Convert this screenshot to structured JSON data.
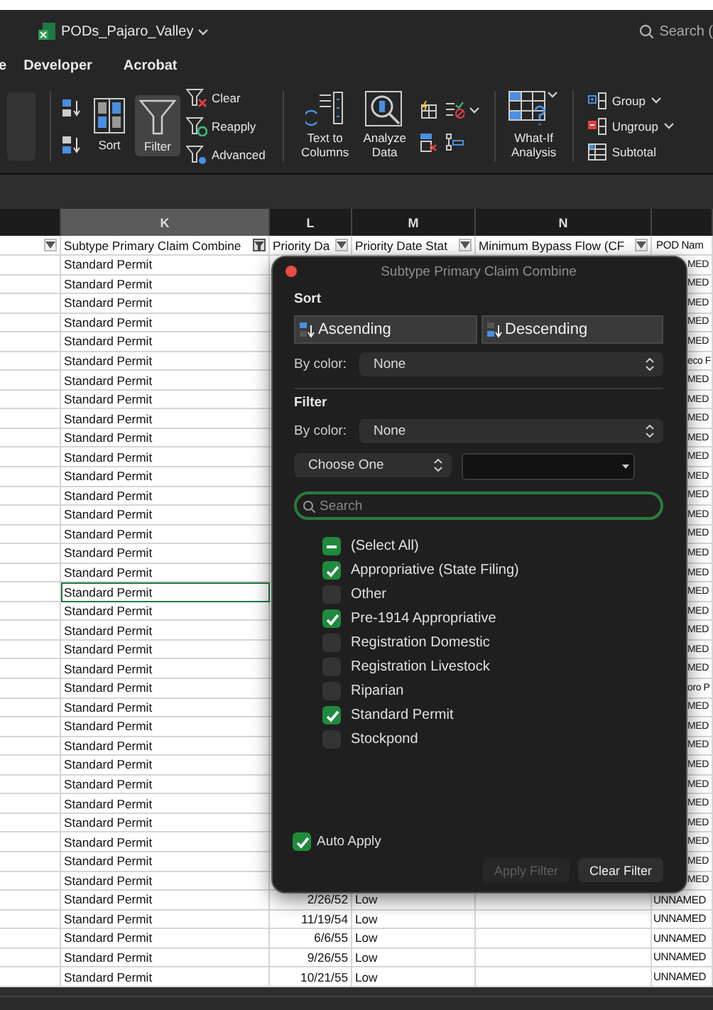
{
  "window": {
    "title": "PODs_Pajaro_Valley",
    "search": "Search ("
  },
  "tabs": [
    {
      "label": "e",
      "selected": false
    },
    {
      "label": "Developer",
      "selected": false
    },
    {
      "label": "Acrobat",
      "selected": false
    }
  ],
  "ribbon": {
    "sort": "Sort",
    "filter": {
      "label": "Filter",
      "selected": true
    },
    "filter_actions": [
      "Clear",
      "Reapply",
      "Advanced"
    ],
    "data_tools": [
      "Text to Columns",
      "Analyze Data"
    ],
    "what_if": "What-If Analysis",
    "outline": [
      "Group",
      "Ungroup",
      "Subtotal"
    ]
  },
  "sheet": {
    "column_letters": [
      {
        "label": "K",
        "selected": true
      },
      {
        "label": "L",
        "selected": false
      },
      {
        "label": "M",
        "selected": false
      },
      {
        "label": "N",
        "selected": false
      }
    ],
    "headers": [
      {
        "label": "Subtype Primary Claim Combine",
        "filtered": true
      },
      {
        "label": "Priority Da",
        "filtered": false
      },
      {
        "label": "Priority Date Stat",
        "filtered": false
      },
      {
        "label": "Minimum Bypass Flow (CF",
        "filtered": false
      },
      {
        "label": "POD Nam"
      }
    ],
    "rows": [
      {
        "subtype": "Standard Permit",
        "pod_name": "MED",
        "selected": false
      },
      {
        "subtype": "Standard Permit",
        "pod_name": "MED",
        "selected": false
      },
      {
        "subtype": "Standard Permit",
        "pod_name": "MED",
        "selected": false
      },
      {
        "subtype": "Standard Permit",
        "pod_name": "MED",
        "selected": false
      },
      {
        "subtype": "Standard Permit",
        "pod_name": "MED",
        "selected": false
      },
      {
        "subtype": "Standard Permit",
        "pod_name": "eco F",
        "selected": false
      },
      {
        "subtype": "Standard Permit",
        "pod_name": "MED",
        "selected": false
      },
      {
        "subtype": "Standard Permit",
        "pod_name": "MED",
        "selected": false
      },
      {
        "subtype": "Standard Permit",
        "pod_name": "MED",
        "selected": false
      },
      {
        "subtype": "Standard Permit",
        "pod_name": "MED",
        "selected": false
      },
      {
        "subtype": "Standard Permit",
        "pod_name": "MED",
        "selected": false
      },
      {
        "subtype": "Standard Permit",
        "pod_name": "MED",
        "selected": false
      },
      {
        "subtype": "Standard Permit",
        "pod_name": "MED",
        "selected": false
      },
      {
        "subtype": "Standard Permit",
        "pod_name": "MED",
        "selected": false
      },
      {
        "subtype": "Standard Permit",
        "pod_name": "MED",
        "selected": false
      },
      {
        "subtype": "Standard Permit",
        "pod_name": "MED",
        "selected": false
      },
      {
        "subtype": "Standard Permit",
        "pod_name": "MED",
        "selected": false
      },
      {
        "subtype": "Standard Permit",
        "pod_name": "MED",
        "selected": true
      },
      {
        "subtype": "Standard Permit",
        "pod_name": "MED",
        "selected": false
      },
      {
        "subtype": "Standard Permit",
        "pod_name": "MED",
        "selected": false
      },
      {
        "subtype": "Standard Permit",
        "pod_name": "MED",
        "selected": false
      },
      {
        "subtype": "Standard Permit",
        "pod_name": "MED",
        "selected": false
      },
      {
        "subtype": "Standard Permit",
        "pod_name": "oro P",
        "selected": false
      },
      {
        "subtype": "Standard Permit",
        "pod_name": "MED",
        "selected": false
      },
      {
        "subtype": "Standard Permit",
        "pod_name": "MED",
        "selected": false
      },
      {
        "subtype": "Standard Permit",
        "pod_name": "MED",
        "selected": false
      },
      {
        "subtype": "Standard Permit",
        "pod_name": "MED",
        "selected": false
      },
      {
        "subtype": "Standard Permit",
        "pod_name": "MED",
        "selected": false
      },
      {
        "subtype": "Standard Permit",
        "pod_name": "MED",
        "selected": false
      },
      {
        "subtype": "Standard Permit",
        "pod_name": "MED",
        "selected": false
      },
      {
        "subtype": "Standard Permit",
        "pod_name": "MED",
        "selected": false
      },
      {
        "subtype": "Standard Permit",
        "pod_name": "MED",
        "selected": false
      },
      {
        "subtype": "Standard Permit",
        "pod_name": "MED",
        "selected": false
      },
      {
        "subtype": "Standard Permit",
        "priority_date": "2/26/52",
        "priority_date_status": "Low",
        "pod_name": "UNNAMED",
        "selected": false
      },
      {
        "subtype": "Standard Permit",
        "priority_date": "11/19/54",
        "priority_date_status": "Low",
        "pod_name": "UNNAMED",
        "selected": false
      },
      {
        "subtype": "Standard Permit",
        "priority_date": "6/6/55",
        "priority_date_status": "Low",
        "pod_name": "UNNAMED",
        "selected": false
      },
      {
        "subtype": "Standard Permit",
        "priority_date": "9/26/55",
        "priority_date_status": "Low",
        "pod_name": "UNNAMED",
        "selected": false
      },
      {
        "subtype": "Standard Permit",
        "priority_date": "10/21/55",
        "priority_date_status": "Low",
        "pod_name": "UNNAMED",
        "selected": false
      }
    ]
  },
  "filter_popup": {
    "title": "Subtype Primary Claim Combine",
    "sort_heading": "Sort",
    "sort_buttons": [
      "Ascending",
      "Descending"
    ],
    "sort_by_color": {
      "label": "By color:",
      "value": "None"
    },
    "filter_heading": "Filter",
    "filter_by_color": {
      "label": "By color:",
      "value": "None"
    },
    "condition": {
      "value": "Choose One"
    },
    "search": {
      "placeholder": "Search"
    },
    "select_all": {
      "label": "(Select All)",
      "mixed": true
    },
    "items": [
      {
        "label": "Appropriative (State Filing)",
        "checked": true
      },
      {
        "label": "Other",
        "checked": false
      },
      {
        "label": "Pre-1914 Appropriative",
        "checked": true
      },
      {
        "label": "Registration Domestic",
        "checked": false
      },
      {
        "label": "Registration Livestock",
        "checked": false
      },
      {
        "label": "Riparian",
        "checked": false
      },
      {
        "label": "Standard Permit",
        "checked": true
      },
      {
        "label": "Stockpond",
        "checked": false
      }
    ],
    "auto_apply": {
      "label": "Auto Apply",
      "checked": true
    },
    "buttons": [
      {
        "label": "Apply Filter",
        "disabled": true
      },
      {
        "label": "Clear Filter",
        "disabled": false
      }
    ]
  }
}
